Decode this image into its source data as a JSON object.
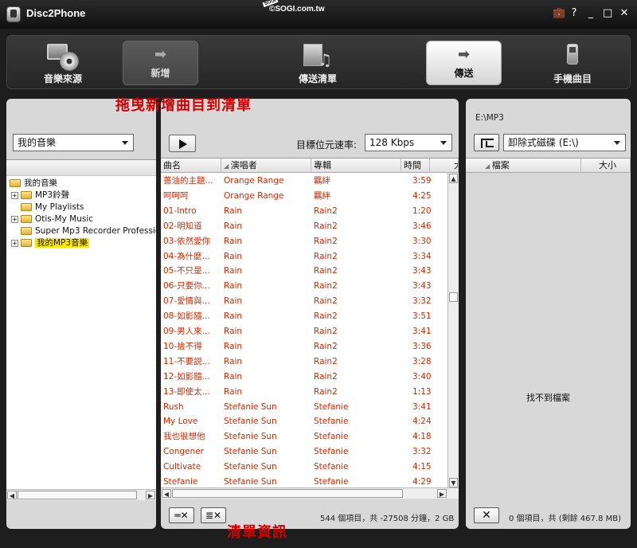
{
  "window": {
    "title": "Disc2Phone",
    "watermark": "©SOGI.com.tw",
    "watermark_badge": "SOGI",
    "controls": [
      "💼",
      "?",
      "_",
      "□",
      "✕"
    ]
  },
  "nav": {
    "source": "音樂來源",
    "add": "新增",
    "list": "傳送清單",
    "send": "傳送",
    "phone": "手機曲目"
  },
  "hints": {
    "drag": "拖曳新增曲目到清單",
    "info": "清單資訊"
  },
  "left": {
    "dropdown": "我的音樂",
    "tree": [
      {
        "label": "我的音樂",
        "level": 0,
        "expander": "",
        "selected": false
      },
      {
        "label": "MP3鈴聲",
        "level": 1,
        "expander": "+",
        "selected": false
      },
      {
        "label": "My Playlists",
        "level": 1,
        "expander": "",
        "selected": false
      },
      {
        "label": "Otis-My Music",
        "level": 1,
        "expander": "+",
        "selected": false
      },
      {
        "label": "Super Mp3 Recorder Professional",
        "level": 1,
        "expander": "",
        "selected": false
      },
      {
        "label": "我的MP3音樂",
        "level": 1,
        "expander": "+",
        "selected": true
      }
    ]
  },
  "middle": {
    "bitrate_label": "目標位元速率:",
    "bitrate_value": "128 Kbps",
    "columns": [
      "曲名",
      "演唱者",
      "專輯",
      "時間",
      "大"
    ],
    "rows": [
      [
        "薔油的主題...",
        "Orange Range",
        "羈絆",
        "3:59"
      ],
      [
        "呵呵呵",
        "Orange Range",
        "羈絆",
        "4:25"
      ],
      [
        "01-Intro",
        "Rain",
        "Rain2",
        "1:20"
      ],
      [
        "02-明知道",
        "Rain",
        "Rain2",
        "3:46"
      ],
      [
        "03-依然愛你",
        "Rain",
        "Rain2",
        "3:30"
      ],
      [
        "04-為什麼...",
        "Rain",
        "Rain2",
        "3:34"
      ],
      [
        "05-不只是...",
        "Rain",
        "Rain2",
        "3:43"
      ],
      [
        "06-只要你...",
        "Rain",
        "Rain2",
        "3:43"
      ],
      [
        "07-愛情與...",
        "Rain",
        "Rain2",
        "3:32"
      ],
      [
        "08-如影隨...",
        "Rain",
        "Rain2",
        "3:51"
      ],
      [
        "09-男人來...",
        "Rain",
        "Rain2",
        "3:41"
      ],
      [
        "10-捨不得",
        "Rain",
        "Rain2",
        "3:36"
      ],
      [
        "11-不要説...",
        "Rain",
        "Rain2",
        "3:28"
      ],
      [
        "12-如影隨...",
        "Rain",
        "Rain2",
        "3:40"
      ],
      [
        "13-即使太...",
        "Rain",
        "Rain2",
        "1:13"
      ],
      [
        "Rush",
        "Stefanie Sun",
        "Stefanie",
        "3:41"
      ],
      [
        "My Love",
        "Stefanie Sun",
        "Stefanie",
        "4:24"
      ],
      [
        "我也很想他",
        "Stefanie Sun",
        "Stefanie",
        "4:18"
      ],
      [
        "Congener",
        "Stefanie Sun",
        "Stefanie",
        "3:32"
      ],
      [
        "Cultivate",
        "Stefanie Sun",
        "Stefanie",
        "4:15"
      ],
      [
        "Stefanie",
        "Stefanie Sun",
        "Stefanie",
        "4:29"
      ]
    ],
    "status": "544 個項目，共 -27508 分鐘，2 GB",
    "remove_btn": "═✕",
    "clear_btn": "≣✕"
  },
  "right": {
    "path": "E:\\MP3",
    "drive": "卸除式磁碟 (E:\\)",
    "columns": [
      "檔案",
      "大小"
    ],
    "empty": "找不到檔案",
    "delete_btn": "✕",
    "status": "0 個項目，共 (剩餘 467.8 MB)"
  },
  "colors": {
    "track_text": "#d42a00",
    "selected_bg": "#ffea00",
    "hint_text": "#d40000"
  }
}
